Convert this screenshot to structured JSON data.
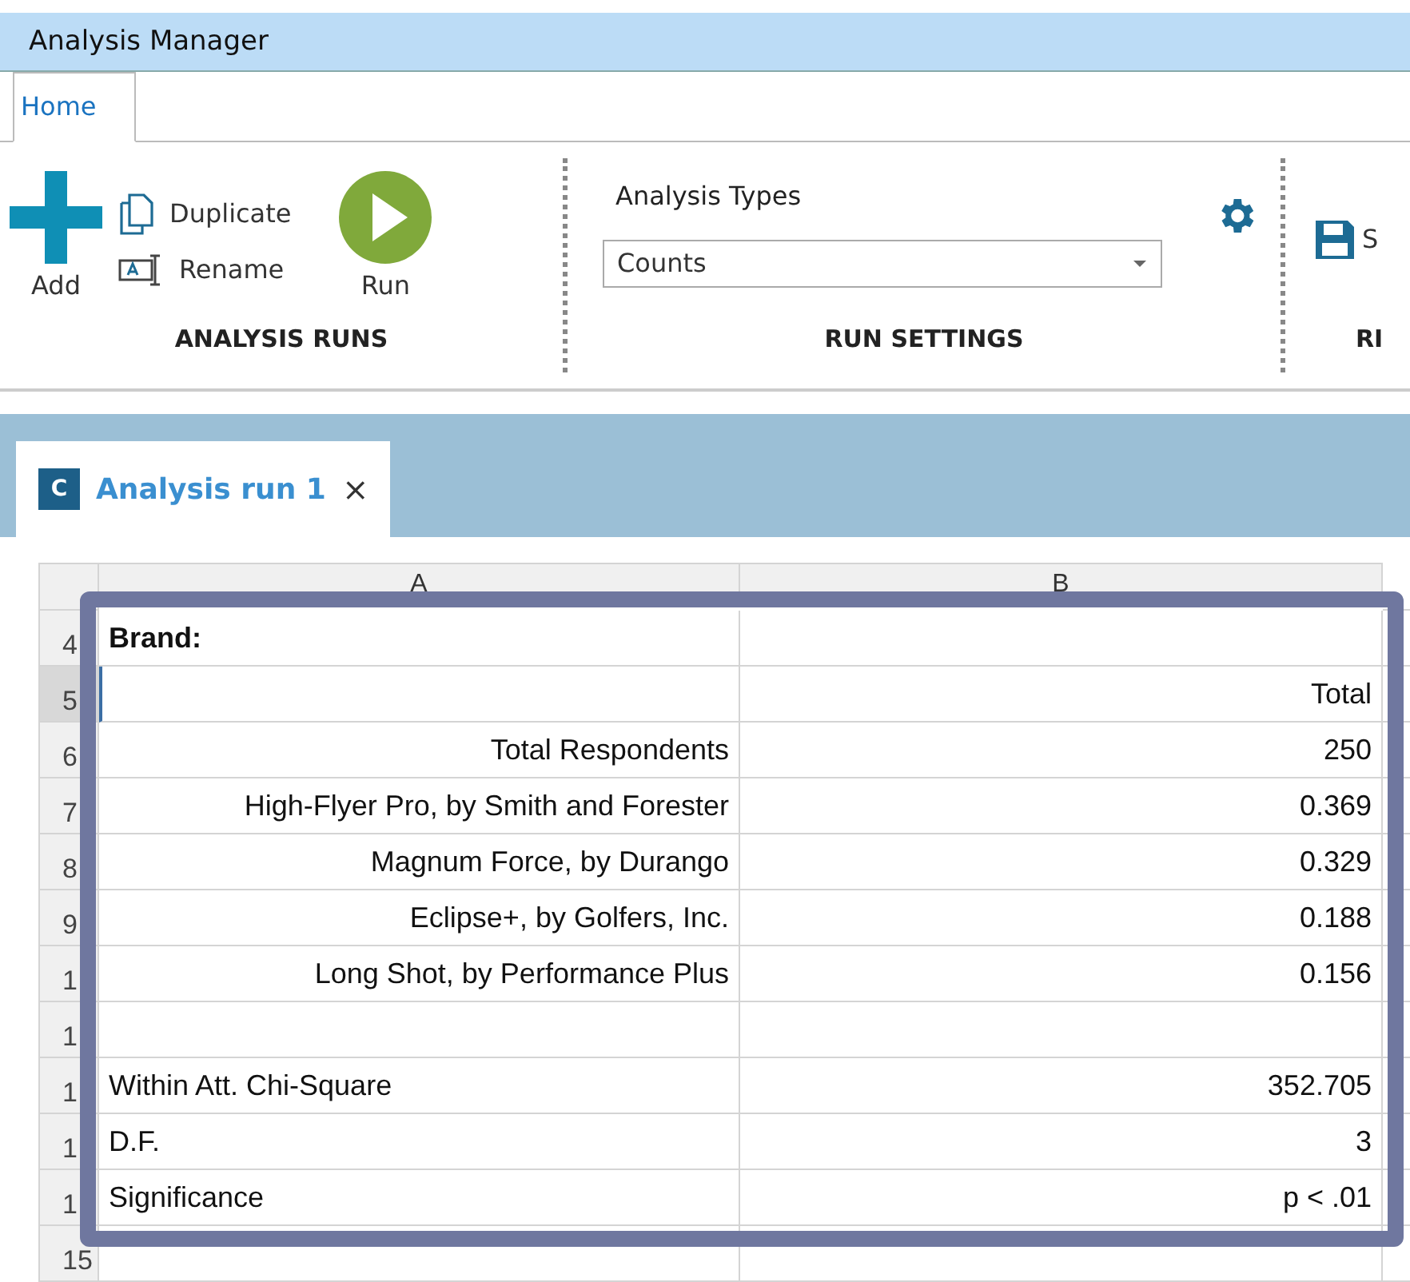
{
  "window": {
    "title": "Analysis Manager"
  },
  "ribbon_tabs": [
    {
      "label": "Home",
      "selected": true
    }
  ],
  "analysis_runs": {
    "add": "Add",
    "duplicate": "Duplicate",
    "rename": "Rename",
    "run": "Run",
    "label": "ANALYSIS RUNS"
  },
  "run_settings": {
    "field_label": "Analysis Types",
    "dropdown_value": "Counts",
    "label": "RUN SETTINGS"
  },
  "cut_group": {
    "button": "S",
    "label": "RI"
  },
  "doc_tabs": [
    {
      "badge": "C",
      "label": "Analysis run 1",
      "close": "×",
      "selected": true
    }
  ],
  "grid": {
    "columns": [
      "A",
      "B"
    ],
    "rows": [
      {
        "header": "4",
        "selected": false,
        "a": "Brand:",
        "kind": "bold",
        "b": ""
      },
      {
        "header": "5",
        "selected": true,
        "a": "",
        "kind": "right",
        "b": "Total"
      },
      {
        "header": "6",
        "selected": false,
        "a": "Total Respondents",
        "kind": "right",
        "b": "250"
      },
      {
        "header": "7",
        "selected": false,
        "a": "High-Flyer Pro, by Smith and Forester",
        "kind": "right",
        "b": "0.369"
      },
      {
        "header": "8",
        "selected": false,
        "a": "Magnum Force, by Durango",
        "kind": "right",
        "b": "0.329"
      },
      {
        "header": "9",
        "selected": false,
        "a": "Eclipse+, by Golfers, Inc.",
        "kind": "right",
        "b": "0.188"
      },
      {
        "header": "1",
        "selected": false,
        "a": "Long Shot, by Performance Plus",
        "kind": "right",
        "b": "0.156"
      },
      {
        "header": "1",
        "selected": false,
        "a": "",
        "kind": "left",
        "b": ""
      },
      {
        "header": "1",
        "selected": false,
        "a": "Within Att. Chi-Square",
        "kind": "left",
        "b": "352.705"
      },
      {
        "header": "1",
        "selected": false,
        "a": "D.F.",
        "kind": "left",
        "b": "3"
      },
      {
        "header": "1",
        "selected": false,
        "a": "Significance",
        "kind": "left",
        "b": "p < .01"
      },
      {
        "header": "15",
        "selected": false,
        "a": "",
        "kind": "left",
        "b": ""
      }
    ]
  }
}
